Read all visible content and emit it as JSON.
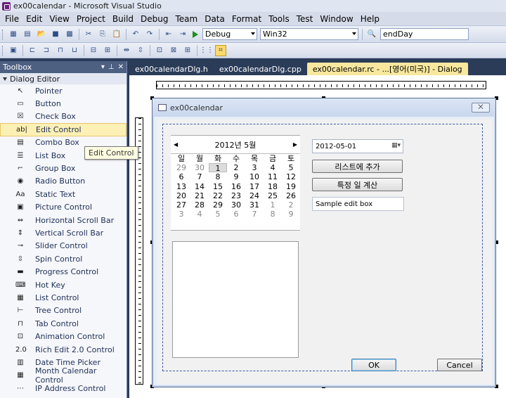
{
  "window": {
    "title": "ex00calendar - Microsoft Visual Studio"
  },
  "menu": [
    "File",
    "Edit",
    "View",
    "Project",
    "Build",
    "Debug",
    "Team",
    "Data",
    "Format",
    "Tools",
    "Test",
    "Window",
    "Help"
  ],
  "toolbar": {
    "config": "Debug",
    "platform": "Win32",
    "find": "endDay"
  },
  "toolbox": {
    "title": "Toolbox",
    "group": "Dialog Editor",
    "items": [
      {
        "label": "Pointer",
        "icon": "pointer-icon",
        "glyph": "↖"
      },
      {
        "label": "Button",
        "icon": "button-icon",
        "glyph": "▭"
      },
      {
        "label": "Check Box",
        "icon": "checkbox-icon",
        "glyph": "☒"
      },
      {
        "label": "Edit Control",
        "icon": "edit-control-icon",
        "glyph": "ab|"
      },
      {
        "label": "Combo Box",
        "icon": "combo-box-icon",
        "glyph": "▤"
      },
      {
        "label": "List Box",
        "icon": "list-box-icon",
        "glyph": "☰"
      },
      {
        "label": "Group Box",
        "icon": "group-box-icon",
        "glyph": "⌐"
      },
      {
        "label": "Radio Button",
        "icon": "radio-button-icon",
        "glyph": "◉"
      },
      {
        "label": "Static Text",
        "icon": "static-text-icon",
        "glyph": "Aa"
      },
      {
        "label": "Picture Control",
        "icon": "picture-control-icon",
        "glyph": "▣"
      },
      {
        "label": "Horizontal Scroll Bar",
        "icon": "hscroll-icon",
        "glyph": "⇔"
      },
      {
        "label": "Vertical Scroll Bar",
        "icon": "vscroll-icon",
        "glyph": "⇕"
      },
      {
        "label": "Slider Control",
        "icon": "slider-icon",
        "glyph": "⊸"
      },
      {
        "label": "Spin Control",
        "icon": "spin-icon",
        "glyph": "⇳"
      },
      {
        "label": "Progress Control",
        "icon": "progress-icon",
        "glyph": "▬"
      },
      {
        "label": "Hot Key",
        "icon": "hot-key-icon",
        "glyph": "⌨"
      },
      {
        "label": "List Control",
        "icon": "list-control-icon",
        "glyph": "▦"
      },
      {
        "label": "Tree Control",
        "icon": "tree-control-icon",
        "glyph": "⊢"
      },
      {
        "label": "Tab Control",
        "icon": "tab-control-icon",
        "glyph": "⊓"
      },
      {
        "label": "Animation Control",
        "icon": "animation-icon",
        "glyph": "⊡"
      },
      {
        "label": "Rich Edit 2.0 Control",
        "icon": "rich-edit-icon",
        "glyph": "2.0"
      },
      {
        "label": "Date Time Picker",
        "icon": "date-time-picker-icon",
        "glyph": "▥"
      },
      {
        "label": "Month Calendar Control",
        "icon": "month-calendar-icon",
        "glyph": "▦"
      },
      {
        "label": "IP Address Control",
        "icon": "ip-address-icon",
        "glyph": "⋯"
      }
    ],
    "selected_index": 3,
    "tooltip": "Edit Control"
  },
  "tabs": [
    {
      "label": "ex00calendarDlg.h",
      "active": false
    },
    {
      "label": "ex00calendarDlg.cpp",
      "active": false
    },
    {
      "label": "ex00calendar.rc - ...[영어(미국)] - Dialog",
      "active": true
    }
  ],
  "dialog": {
    "title": "ex00calendar",
    "close": "⨉",
    "calendar": {
      "month_label": "2012년 5월",
      "weekdays": [
        "일",
        "월",
        "화",
        "수",
        "목",
        "금",
        "토"
      ],
      "weeks": [
        [
          "29",
          "30",
          "1",
          "2",
          "3",
          "4",
          "5"
        ],
        [
          "6",
          "7",
          "8",
          "9",
          "10",
          "11",
          "12"
        ],
        [
          "13",
          "14",
          "15",
          "16",
          "17",
          "18",
          "19"
        ],
        [
          "20",
          "21",
          "22",
          "23",
          "24",
          "25",
          "26"
        ],
        [
          "27",
          "28",
          "29",
          "30",
          "31",
          "1",
          "2"
        ],
        [
          "3",
          "4",
          "5",
          "6",
          "7",
          "8",
          "9"
        ]
      ]
    },
    "date_value": "2012-05-01",
    "add_button": "리스트에 추가",
    "calc_button": "특정 일 계산",
    "edit_text": "Sample edit box",
    "ok": "OK",
    "cancel": "Cancel"
  }
}
